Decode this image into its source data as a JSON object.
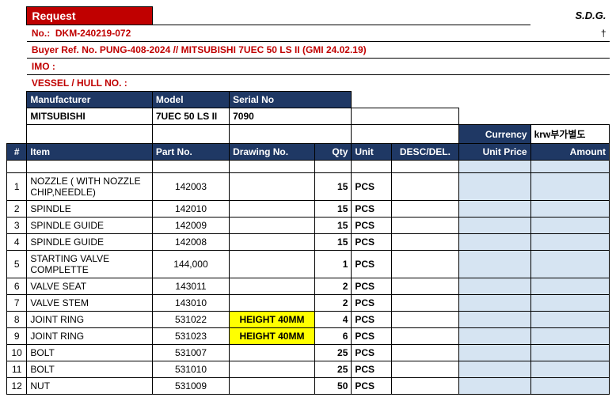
{
  "header": {
    "request_label": "Request",
    "sdg": "S.D.G.",
    "no_label": "No.:",
    "no_value": "DKM-240219-072",
    "buyer_ref": "Buyer Ref. No. PUNG-408-2024 // MITSUBISHI 7UEC 50 LS II (GMI 24.02.19)",
    "imo_label": "IMO :",
    "vessel_label": "VESSEL / HULL NO. :",
    "cross": "†"
  },
  "meta_headers": {
    "manufacturer": "Manufacturer",
    "model": "Model",
    "serial": "Serial No"
  },
  "meta_values": {
    "manufacturer": "MITSUBISHI",
    "model": "7UEC 50 LS II",
    "serial": "7090"
  },
  "currency": {
    "label": "Currency",
    "value": "krw부가별도"
  },
  "columns": {
    "hash": "#",
    "item": "Item",
    "part": "Part No.",
    "drawing": "Drawing No.",
    "qty": "Qty",
    "unit": "Unit",
    "desc": "DESC/DEL.",
    "price": "Unit Price",
    "amount": "Amount"
  },
  "rows": [
    {
      "n": "1",
      "item": "NOZZLE ( WITH NOZZLE CHIP,NEEDLE)",
      "part": "142003",
      "drawing": "",
      "qty": "15",
      "unit": "PCS",
      "hl": false
    },
    {
      "n": "2",
      "item": "SPINDLE",
      "part": "142010",
      "drawing": "",
      "qty": "15",
      "unit": "PCS",
      "hl": false
    },
    {
      "n": "3",
      "item": "SPINDLE GUIDE",
      "part": "142009",
      "drawing": "",
      "qty": "15",
      "unit": "PCS",
      "hl": false
    },
    {
      "n": "4",
      "item": "SPINDLE GUIDE",
      "part": "142008",
      "drawing": "",
      "qty": "15",
      "unit": "PCS",
      "hl": false
    },
    {
      "n": "5",
      "item": "STARTING VALVE COMPLETTE",
      "part": "144,000",
      "drawing": "",
      "qty": "1",
      "unit": "PCS",
      "hl": false
    },
    {
      "n": "6",
      "item": "VALVE SEAT",
      "part": "143011",
      "drawing": "",
      "qty": "2",
      "unit": "PCS",
      "hl": false
    },
    {
      "n": "7",
      "item": "VALVE STEM",
      "part": "143010",
      "drawing": "",
      "qty": "2",
      "unit": "PCS",
      "hl": false
    },
    {
      "n": "8",
      "item": "JOINT RING",
      "part": "531022",
      "drawing": "HEIGHT 40MM",
      "qty": "4",
      "unit": "PCS",
      "hl": true
    },
    {
      "n": "9",
      "item": "JOINT RING",
      "part": "531023",
      "drawing": "HEIGHT 40MM",
      "qty": "6",
      "unit": "PCS",
      "hl": true
    },
    {
      "n": "10",
      "item": "BOLT",
      "part": "531007",
      "drawing": "",
      "qty": "25",
      "unit": "PCS",
      "hl": false
    },
    {
      "n": "11",
      "item": "BOLT",
      "part": "531010",
      "drawing": "",
      "qty": "25",
      "unit": "PCS",
      "hl": false
    },
    {
      "n": "12",
      "item": "NUT",
      "part": "531009",
      "drawing": "",
      "qty": "50",
      "unit": "PCS",
      "hl": false
    }
  ]
}
